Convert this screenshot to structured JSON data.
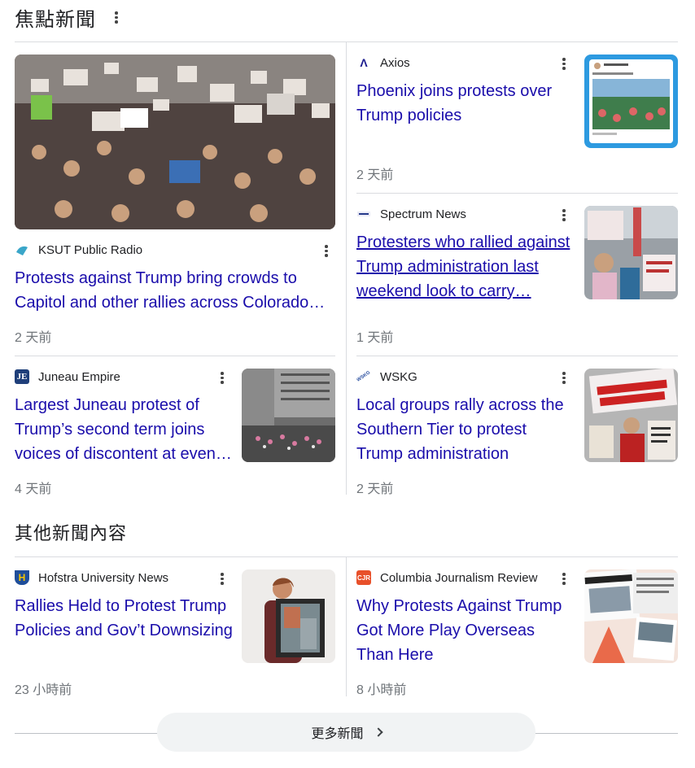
{
  "top_stories": {
    "title": "焦點新聞",
    "featured": {
      "source": "KSUT Public Radio",
      "headline": "Protests against Trump bring crowds to Capitol and other rallies across Colorado…",
      "time": "2 天前"
    },
    "items": [
      {
        "source": "Axios",
        "headline": "Phoenix joins protests over Trump policies",
        "time": "2 天前"
      },
      {
        "source": "Spectrum News",
        "headline": "Protesters who rallied against Trump administration last weekend look to carry…",
        "time": "1 天前"
      },
      {
        "source": "Juneau Empire",
        "headline": "Largest Juneau protest of Trump’s second term joins voices of discontent at even…",
        "time": "4 天前"
      },
      {
        "source": "WSKG",
        "headline": "Local groups rally across the Southern Tier to protest Trump administration",
        "time": "2 天前"
      }
    ]
  },
  "more_news": {
    "title": "其他新聞內容",
    "items": [
      {
        "source": "Hofstra University News",
        "headline": "Rallies Held to Protest Trump Policies and Gov’t Downsizing",
        "time": "23 小時前"
      },
      {
        "source": "Columbia Journalism Review",
        "headline": "Why Protests Against Trump Got More Play Overseas Than Here",
        "time": "8 小時前"
      }
    ]
  },
  "more_button": {
    "label": "更多新聞"
  },
  "logos": {
    "axios": "Λ",
    "juneau": "JE",
    "wskg": "WSKG",
    "cjr": "CJR",
    "hofstra": "H"
  },
  "colors": {
    "link": "#1a0dab",
    "meta": "#70757a",
    "divider": "#dadce0"
  }
}
